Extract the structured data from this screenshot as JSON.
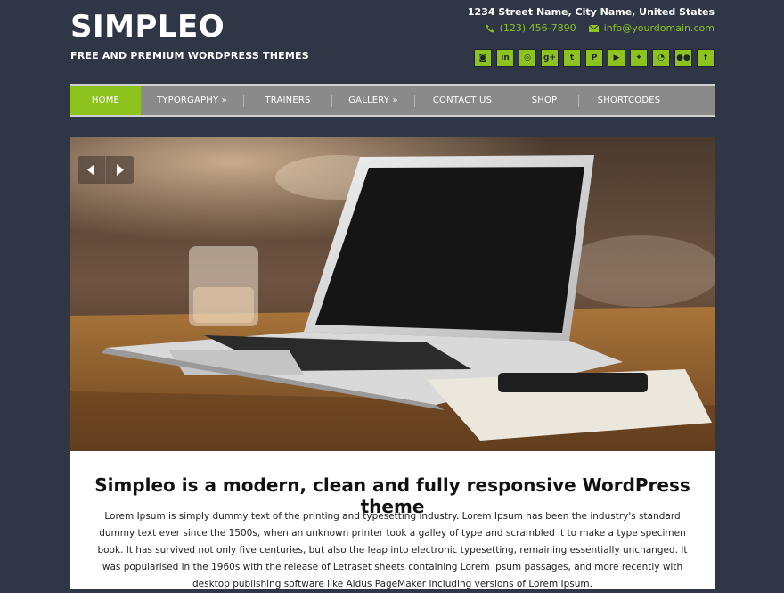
{
  "site": {
    "logo": "SIMPLEO",
    "tagline": "FREE AND PREMIUM WORDPRESS THEMES"
  },
  "header": {
    "address": "1234 Street Name, City Name, United States",
    "phone": "(123) 456-7890",
    "email": "info@yourdomain.com",
    "phone_icon": "phone-icon",
    "email_icon": "envelope-icon",
    "accent_color": "#8dc21f"
  },
  "social": [
    {
      "name": "instagram-icon",
      "glyph": "◙"
    },
    {
      "name": "linkedin-icon",
      "glyph": "in"
    },
    {
      "name": "dribbble-icon",
      "glyph": "◎"
    },
    {
      "name": "google-plus-icon",
      "glyph": "g+"
    },
    {
      "name": "tumblr-icon",
      "glyph": "t"
    },
    {
      "name": "pinterest-icon",
      "glyph": "P"
    },
    {
      "name": "youtube-icon",
      "glyph": "▶"
    },
    {
      "name": "twitter-icon",
      "glyph": "✦"
    },
    {
      "name": "rss-icon",
      "glyph": "◔"
    },
    {
      "name": "flickr-icon",
      "glyph": "●●"
    },
    {
      "name": "facebook-icon",
      "glyph": "f"
    }
  ],
  "nav": {
    "items": [
      {
        "label": "HOME",
        "active": true
      },
      {
        "label": "TYPORGAPHY »",
        "active": false
      },
      {
        "label": "TRAINERS",
        "active": false
      },
      {
        "label": "GALLERY »",
        "active": false
      },
      {
        "label": "CONTACT US",
        "active": false
      },
      {
        "label": "SHOP",
        "active": false
      },
      {
        "label": "SHORTCODES",
        "active": false
      }
    ]
  },
  "slider": {
    "prev_icon": "chevron-left-icon",
    "next_icon": "chevron-right-icon"
  },
  "main": {
    "heading": "Simpleo is a modern, clean and fully responsive WordPress theme",
    "body": "Lorem Ipsum is simply dummy text of the printing and typesetting industry. Lorem Ipsum has been the industry's standard dummy text ever since the 1500s, when an unknown printer took a galley of type and scrambled it to make a type specimen book. It has survived not only five centuries, but also the leap into electronic typesetting, remaining essentially unchanged. It was popularised in the 1960s with the release of Letraset sheets containing Lorem Ipsum passages, and more recently with desktop publishing software like Aldus PageMaker including versions of Lorem Ipsum."
  }
}
